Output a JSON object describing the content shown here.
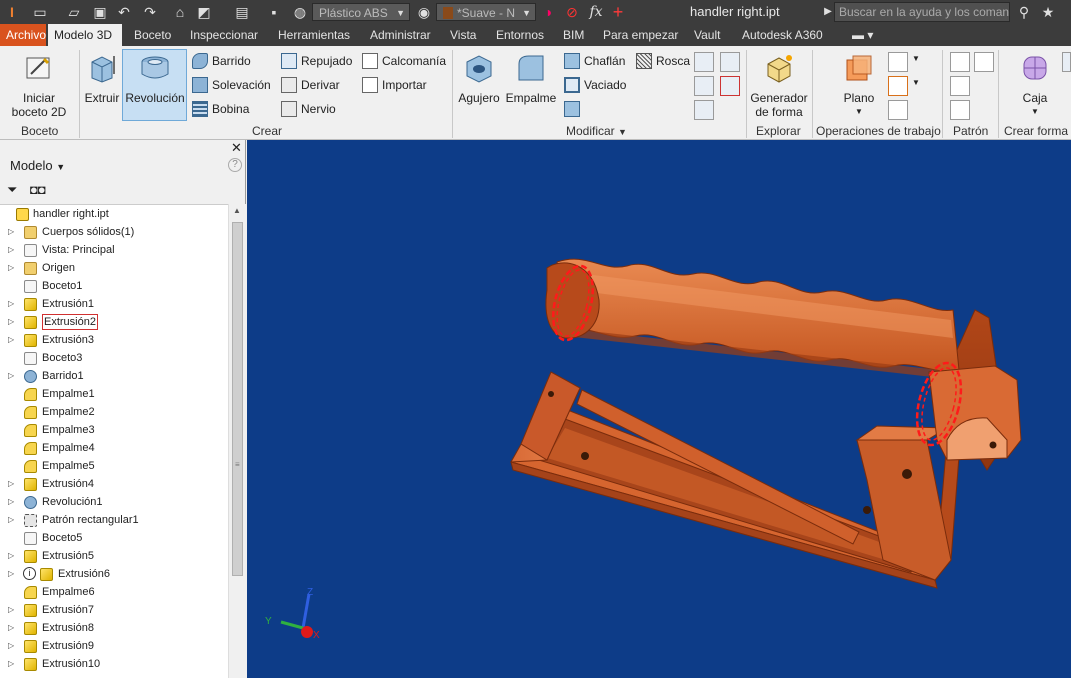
{
  "titlebar": {
    "material": "Plástico ABS",
    "appearance": "*Suave - N",
    "document_title": "handler right.ipt",
    "help_search_placeholder": "Buscar en la ayuda y los comand",
    "fx_label": "fx"
  },
  "tabs": [
    {
      "label": "Archivo"
    },
    {
      "label": "Modelo 3D"
    },
    {
      "label": "Boceto"
    },
    {
      "label": "Inspeccionar"
    },
    {
      "label": "Herramientas"
    },
    {
      "label": "Administrar"
    },
    {
      "label": "Vista"
    },
    {
      "label": "Entornos"
    },
    {
      "label": "BIM"
    },
    {
      "label": "Para empezar"
    },
    {
      "label": "Vault"
    },
    {
      "label": "Autodesk A360"
    }
  ],
  "ribbon": {
    "start_sketch_1": "Iniciar",
    "start_sketch_2": "boceto 2D",
    "extrude": "Extruir",
    "revolve": "Revolución",
    "sweep": "Barrido",
    "loft": "Solevación",
    "coil": "Bobina",
    "emboss": "Repujado",
    "derive": "Derivar",
    "rib": "Nervio",
    "decal": "Calcomanía",
    "import": "Importar",
    "hole": "Agujero",
    "fillet": "Empalme",
    "chamfer": "Chaflán",
    "thread": "Rosca",
    "shell": "Vaciado",
    "shape_gen_1": "Generador",
    "shape_gen_2": "de forma",
    "plane": "Plano",
    "box": "Caja",
    "groups": {
      "sketch": "Boceto",
      "create": "Crear",
      "modify": "Modificar",
      "explore": "Explorar",
      "work_features": "Operaciones de trabajo",
      "pattern": "Patrón",
      "freeform": "Crear forma"
    }
  },
  "browser": {
    "title": "Modelo",
    "nodes": [
      {
        "label": "handler right.ipt",
        "icon": "part-icon",
        "expand": ""
      },
      {
        "label": "Cuerpos sólidos(1)",
        "icon": "solid-bodies-icon",
        "expand": "▷"
      },
      {
        "label": "Vista: Principal",
        "icon": "view-icon",
        "expand": "▷"
      },
      {
        "label": "Origen",
        "icon": "folder-icon",
        "expand": "▷"
      },
      {
        "label": "Boceto1",
        "icon": "sketch-icon",
        "expand": ""
      },
      {
        "label": "Extrusión1",
        "icon": "extrude-icon",
        "expand": "▷"
      },
      {
        "label": "Extrusión2",
        "icon": "extrude-icon",
        "expand": "▷"
      },
      {
        "label": "Extrusión3",
        "icon": "extrude-icon",
        "expand": "▷"
      },
      {
        "label": "Boceto3",
        "icon": "sketch-icon",
        "expand": ""
      },
      {
        "label": "Barrido1",
        "icon": "sweep-icon",
        "expand": "▷"
      },
      {
        "label": "Empalme1",
        "icon": "fillet-icon",
        "expand": ""
      },
      {
        "label": "Empalme2",
        "icon": "fillet-icon",
        "expand": ""
      },
      {
        "label": "Empalme3",
        "icon": "fillet-icon",
        "expand": ""
      },
      {
        "label": "Empalme4",
        "icon": "fillet-icon",
        "expand": ""
      },
      {
        "label": "Empalme5",
        "icon": "fillet-icon",
        "expand": ""
      },
      {
        "label": "Extrusión4",
        "icon": "extrude-icon",
        "expand": "▷"
      },
      {
        "label": "Revolución1",
        "icon": "revolve-icon",
        "expand": "▷"
      },
      {
        "label": "Patrón rectangular1",
        "icon": "pattern-icon",
        "expand": "▷"
      },
      {
        "label": "Boceto5",
        "icon": "sketch-icon",
        "expand": ""
      },
      {
        "label": "Extrusión5",
        "icon": "extrude-icon",
        "expand": "▷"
      },
      {
        "label": "Extrusión6",
        "icon": "extrude-icon",
        "expand": "▷"
      },
      {
        "label": "Empalme6",
        "icon": "fillet-icon",
        "expand": ""
      },
      {
        "label": "Extrusión7",
        "icon": "extrude-icon",
        "expand": "▷"
      },
      {
        "label": "Extrusión8",
        "icon": "extrude-icon",
        "expand": "▷"
      },
      {
        "label": "Extrusión9",
        "icon": "extrude-icon",
        "expand": "▷"
      },
      {
        "label": "Extrusión10",
        "icon": "extrude-icon",
        "expand": "▷"
      }
    ]
  },
  "viewcube": {
    "x": "X",
    "y": "Y",
    "z": "Z"
  },
  "colors": {
    "viewport_bg": "#0d3c88",
    "part_orange": "#cf5f2a",
    "highlight_red": "#ff1a1a",
    "file_tab": "#d9531e"
  }
}
